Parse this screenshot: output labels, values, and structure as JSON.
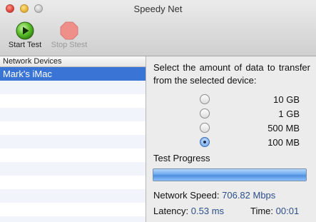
{
  "window": {
    "title": "Speedy Net"
  },
  "toolbar": {
    "start_label": "Start Test",
    "stop_label": "Stop Stest"
  },
  "sidebar": {
    "header": "Network Devices",
    "items": [
      {
        "label": "Mark's iMac",
        "selected": true
      }
    ]
  },
  "transfer": {
    "prompt": "Select the amount of data to transfer from the selected device:",
    "options": [
      {
        "label": "10 GB",
        "checked": false
      },
      {
        "label": "1 GB",
        "checked": false
      },
      {
        "label": "500 MB",
        "checked": false
      },
      {
        "label": "100 MB",
        "checked": true
      }
    ]
  },
  "progress": {
    "title": "Test Progress",
    "fraction": 1.0
  },
  "stats": {
    "speed_label": "Network Speed:",
    "speed_value": "706.82 Mbps",
    "latency_label": "Latency:",
    "latency_value": "0.53 ms",
    "time_label": "Time:",
    "time_value": "00:01"
  },
  "colors": {
    "selection": "#3a75d6",
    "value_text": "#2c4f8a",
    "progress": "#4f8fdc"
  }
}
